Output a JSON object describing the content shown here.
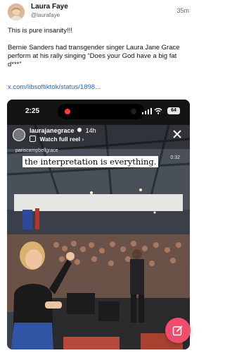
{
  "post": {
    "author_name": "Laura Faye",
    "author_handle": "@laurafaye",
    "timestamp": "35m",
    "text_line1": "This is pure insanity!!!",
    "text_line2": "Bernie Sanders had transgender singer Laura Jane Grace perform at his rally singing “Does your God have a big fat d***”",
    "link": "x.com/libsoftiktok/status/1898..."
  },
  "video": {
    "status_time": "2:25",
    "battery": "64",
    "story_username": "laurajanegrace",
    "story_age": "14h",
    "story_action": "Watch full reel",
    "story_action_chevron": "›",
    "credit": "pariscampbellgrace",
    "timer": "0:32",
    "caption": "the interpretation is everything."
  },
  "icons": {
    "avatar": "author-avatar",
    "record": "recording-dot-icon",
    "signal": "signal-icon",
    "wifi": "wifi-icon",
    "close": "close-icon",
    "compose": "compose-icon"
  },
  "colors": {
    "link": "#2a66d8",
    "fab": "#ef4d6c",
    "record": "#ff3b30"
  }
}
